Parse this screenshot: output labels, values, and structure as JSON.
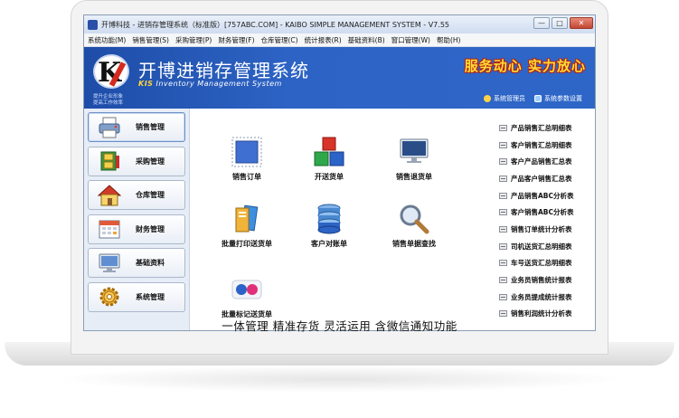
{
  "window": {
    "title": "开博科技 - 进销存管理系统（标准版）[757ABC.COM] - KAIBO SIMPLE MANAGEMENT SYSTEM - V7.55",
    "buttons": {
      "minimize": "—",
      "maximize": "□",
      "close": "✕"
    }
  },
  "menu": [
    "系统功能(M)",
    "销售管理(S)",
    "采购管理(P)",
    "财务管理(F)",
    "仓库管理(C)",
    "统计报表(R)",
    "基础资料(B)",
    "窗口管理(W)",
    "帮助(H)"
  ],
  "banner": {
    "logo_letter": "K",
    "logo_sub1": "提升企业形象",
    "logo_sub2": "提高工作效率",
    "app_name": "开博进销存管理系统",
    "app_name_en_prefix": "KIS",
    "app_name_en": " Inventory Management System",
    "slogan": "服务动心 实力放心",
    "links": [
      "系统管理员",
      "系统参数设置"
    ]
  },
  "sidebar": [
    {
      "label": "销售管理",
      "icon": "printer-icon"
    },
    {
      "label": "采购管理",
      "icon": "cabinet-icon"
    },
    {
      "label": "仓库管理",
      "icon": "house-icon"
    },
    {
      "label": "财务管理",
      "icon": "calendar-icon"
    },
    {
      "label": "基础资料",
      "icon": "monitor-icon"
    },
    {
      "label": "系统管理",
      "icon": "gear-icon"
    }
  ],
  "tiles": [
    {
      "label": "销售订单",
      "icon": "stamp-icon"
    },
    {
      "label": "开送货单",
      "icon": "cubes-icon"
    },
    {
      "label": "销售退货单",
      "icon": "monitor-icon"
    },
    {
      "label": "批量打印送货单",
      "icon": "folder-icon"
    },
    {
      "label": "客户对账单",
      "icon": "database-icon"
    },
    {
      "label": "销售单据查找",
      "icon": "magnifier-icon"
    },
    {
      "label": "批量标记送货单",
      "icon": "dots-icon"
    }
  ],
  "reports": [
    "产品销售汇总明细表",
    "客户销售汇总明细表",
    "客户产品销售汇总表",
    "产品客户销售汇总表",
    "产品销售ABC分析表",
    "客户销售ABC分析表",
    "销售订单统计分析表",
    "司机送货汇总明细表",
    "车号送货汇总明细表",
    "业务员销售统计报表",
    "业务员提成统计报表",
    "销售利润统计分析表"
  ],
  "caption": "一体管理 精准存货 灵活运用 含微信通知功能",
  "colors": {
    "banner_blue": "#2d63c4",
    "slogan_yellow": "#ffdd33",
    "slogan_outline": "#b3231a"
  }
}
